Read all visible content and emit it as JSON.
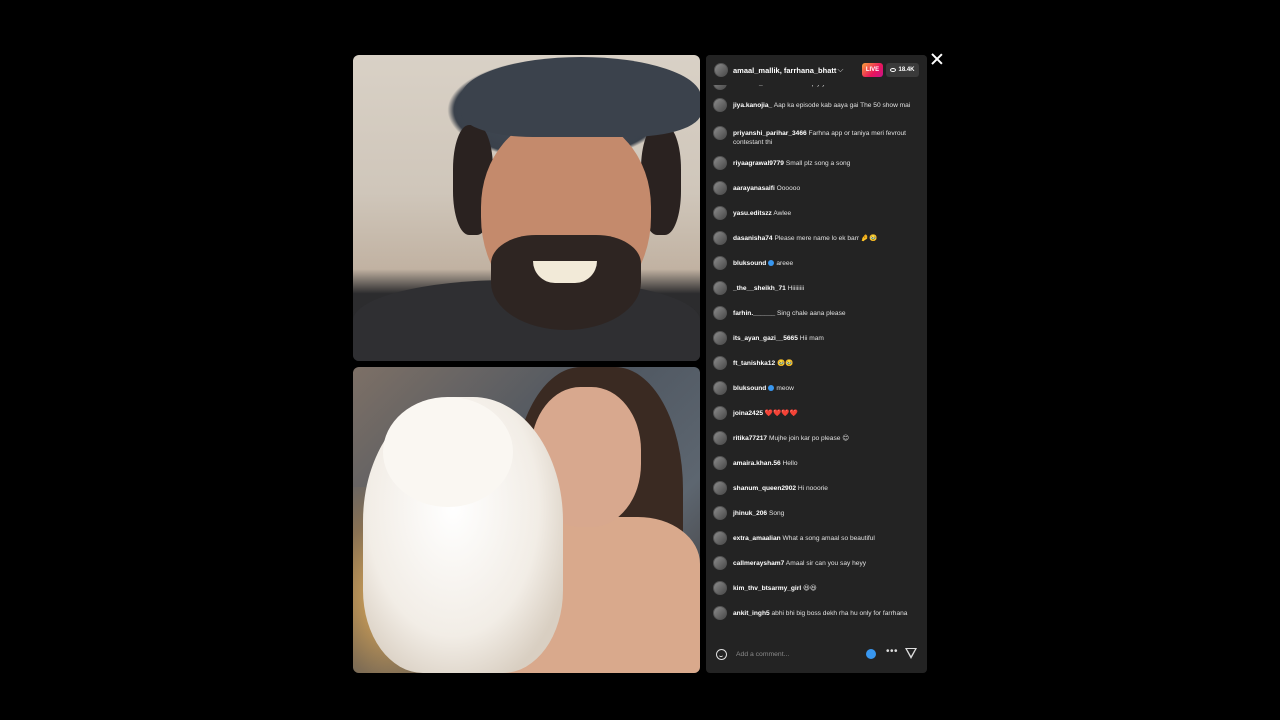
{
  "header": {
    "hosts": "amaal_mallik, farrhana_bhatt",
    "live_label": "LIVE",
    "viewer_count": "18.4K"
  },
  "comments": [
    {
      "user": "tomader_aamar",
      "text": "Please reply yaar",
      "verified": false
    },
    {
      "user": "jiya.kanojia_",
      "text": "Aap ka episode kab aaya gai The 50 show mai",
      "verified": false
    },
    {
      "user": "priyanshi_parihar_3466",
      "text": "Farhna app or taniya meri fevrout contestant thi",
      "verified": false
    },
    {
      "user": "riyaagrawal9779",
      "text": "Small plz song a song",
      "verified": false
    },
    {
      "user": "aarayanasaifi",
      "text": "Oooooo",
      "verified": false
    },
    {
      "user": "yasu.editszz",
      "text": "Awlee",
      "verified": false
    },
    {
      "user": "dasanisha74",
      "text": "Please mere name lo ek barr 🤌🥹",
      "verified": false
    },
    {
      "user": "bluksound",
      "text": "areee",
      "verified": true
    },
    {
      "user": "_the__sheikh_71",
      "text": "Hiiiiiiii",
      "verified": false
    },
    {
      "user": "farhin.______",
      "text": "Sing chale aana please",
      "verified": false
    },
    {
      "user": "its_ayan_gazi__5665",
      "text": "Hii mam",
      "verified": false
    },
    {
      "user": "ft_tanishka12",
      "text": "🥹🥹",
      "verified": false
    },
    {
      "user": "bluksound",
      "text": "meow",
      "verified": true
    },
    {
      "user": "joina2425",
      "text": "❤️❤️❤️❤️",
      "verified": false
    },
    {
      "user": "ritika77217",
      "text": "Mujhe join kar po please 😊",
      "verified": false
    },
    {
      "user": "amaira.khan.56",
      "text": "Hello",
      "verified": false
    },
    {
      "user": "shanum_queen2902",
      "text": "Hi nooorie",
      "verified": false
    },
    {
      "user": "jhinuk_206",
      "text": "Song",
      "verified": false
    },
    {
      "user": "extra_amaalian",
      "text": "What a song amaal so beautiful",
      "verified": false
    },
    {
      "user": "callmeraysham7",
      "text": "Amaal sir can you say heyy",
      "verified": false
    },
    {
      "user": "kim_thv_btsarmy_girl",
      "text": "😆😆",
      "verified": false
    },
    {
      "user": "ankit_ingh5",
      "text": "abhi bhi big boss dekh rha hu only for farrhana",
      "verified": false
    }
  ],
  "comment_bar": {
    "placeholder": "Add a comment..."
  },
  "icons": {
    "close": "close-icon",
    "emoji": "smile-icon",
    "more": "more-icon",
    "send": "send-icon",
    "viewers": "eye-icon"
  },
  "colors": {
    "panel_bg": "#232323",
    "live_gradient_start": "#f9a23a",
    "live_gradient_end": "#c9138a",
    "verified_blue": "#3897f0"
  }
}
